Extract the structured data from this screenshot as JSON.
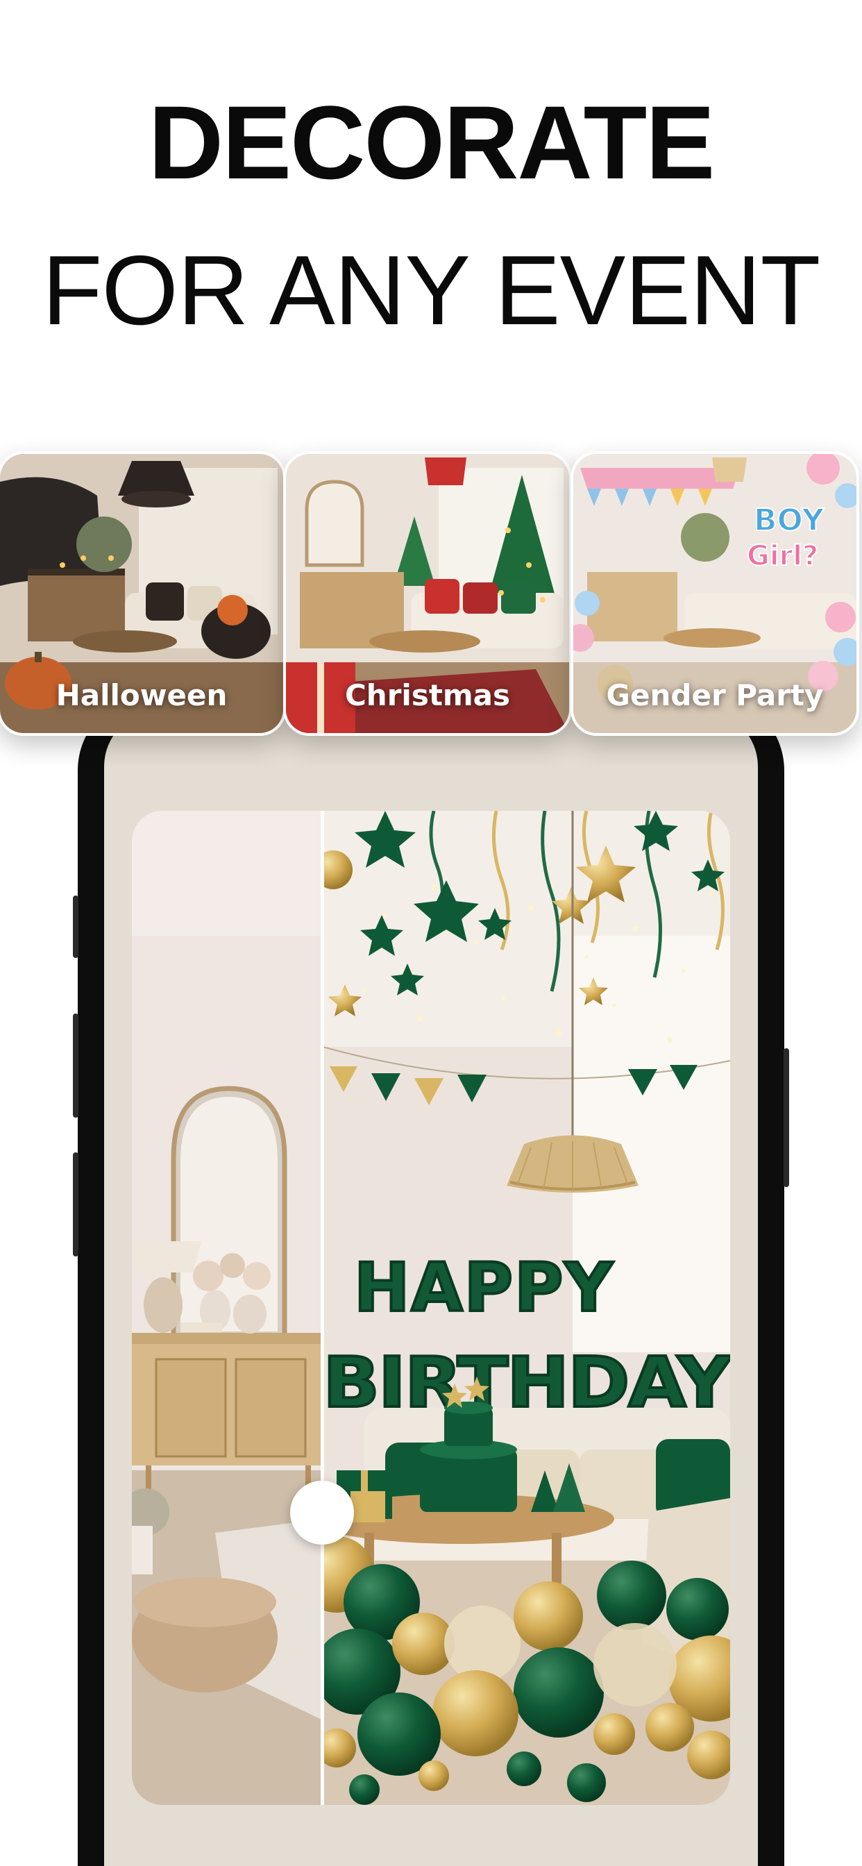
{
  "headline": {
    "line1": "DECORATE",
    "line2": "FOR ANY EVENT"
  },
  "event_cards": [
    {
      "label": "Halloween",
      "icon": "pumpkin-scene"
    },
    {
      "label": "Christmas",
      "icon": "christmas-tree-scene"
    },
    {
      "label": "Gender Party",
      "icon": "balloon-scene"
    }
  ],
  "compare": {
    "after_banner_line1": "HAPPY",
    "after_banner_line2": "BIRTHDAY"
  },
  "colors": {
    "headline": "#0a0a0a",
    "accent_green": "#0f5a36",
    "accent_gold": "#d8b25a",
    "card_label": "#ffffff"
  }
}
